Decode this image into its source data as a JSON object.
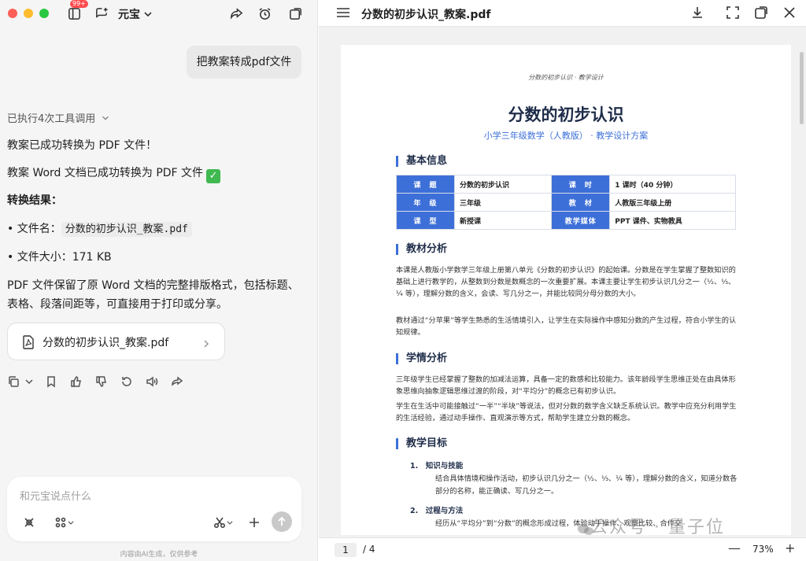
{
  "app": {
    "name": "元宝",
    "badge": "99+"
  },
  "chat": {
    "user_message": "把教案转成pdf文件",
    "tool_calls": "已执行4次工具调用",
    "lines": {
      "success": "教案已成功转换为 PDF 文件！",
      "converted": "教案 Word 文档已成功转换为 PDF 文件",
      "result_heading": "转换结果：",
      "filename_label": "• 文件名：",
      "filename_value": "分数的初步认识_教案.pdf",
      "filesize": "• 文件大小：171 KB",
      "summary_1": "PDF 文件保留了原 Word 文档的完整排版格式，包括标题、",
      "summary_2": "表格、段落间距等，可直接用于打印或分享。"
    },
    "file_card": "分数的初步认识_教案.pdf",
    "composer_placeholder": "和元宝说点什么",
    "disclaimer": "内容由AI生成，仅供参考"
  },
  "viewer": {
    "title": "分数的初步认识_教案.pdf",
    "page_current": "1",
    "page_total": "/  4",
    "zoom": "73%",
    "zoom_minus": "—",
    "zoom_plus": "+",
    "watermark": "公众号 · 量子位"
  },
  "doc": {
    "header": "分数的初步认识 · 教学设计",
    "title": "分数的初步认识",
    "subtitle": "小学三年级数学（人教版） · 教学设计方案",
    "sections": {
      "basic": "基本信息",
      "material": "教材分析",
      "students": "学情分析",
      "goals": "教学目标"
    },
    "info": {
      "r1": [
        "课　题",
        "分数的初步认识",
        "课　时",
        "1 课时（40 分钟）"
      ],
      "r2": [
        "年　级",
        "三年级",
        "教　材",
        "人教版三年级上册"
      ],
      "r3": [
        "课　型",
        "新授课",
        "教学媒体",
        "PPT 课件、实物教具"
      ]
    },
    "material_p1": "本课是人教版小学数学三年级上册第八单元《分数的初步认识》的起始课。分数是在学生掌握了整数知识的基础上进行教学的，从整数到分数是数概念的一次重要扩展。本课主要让学生初步认识几分之一（½、⅓、¼ 等），理解分数的含义，会读、写几分之一，并能比较同分母分数的大小。",
    "material_p2": "教材通过“分苹果”等学生熟悉的生活情境引入，让学生在实际操作中感知分数的产生过程，符合小学生的认知规律。",
    "students_p1": "三年级学生已经掌握了整数的加减法运算，具备一定的数感和比较能力。该年龄段学生思维正处在由具体形象思维向抽象逻辑思维过渡的阶段，对“平均分”的概念已有初步认识。",
    "students_p2": "学生在生活中可能接触过“一半”“半块”等说法，但对分数的数学含义缺乏系统认识。教学中应充分利用学生的生活经验，通过动手操作、直观演示等方式，帮助学生建立分数的概念。",
    "goal1_title": "1.　知识与技能",
    "goal1_text": "结合具体情境和操作活动，初步认识几分之一（½、⅓、¼ 等），理解分数的含义，知道分数各部分的名称，能正确读、写几分之一。",
    "goal2_title": "2.　过程与方法",
    "goal2_text": "经历从“平均分”到“分数”的概念形成过程，体验动手操作、观察比较、合作交"
  }
}
